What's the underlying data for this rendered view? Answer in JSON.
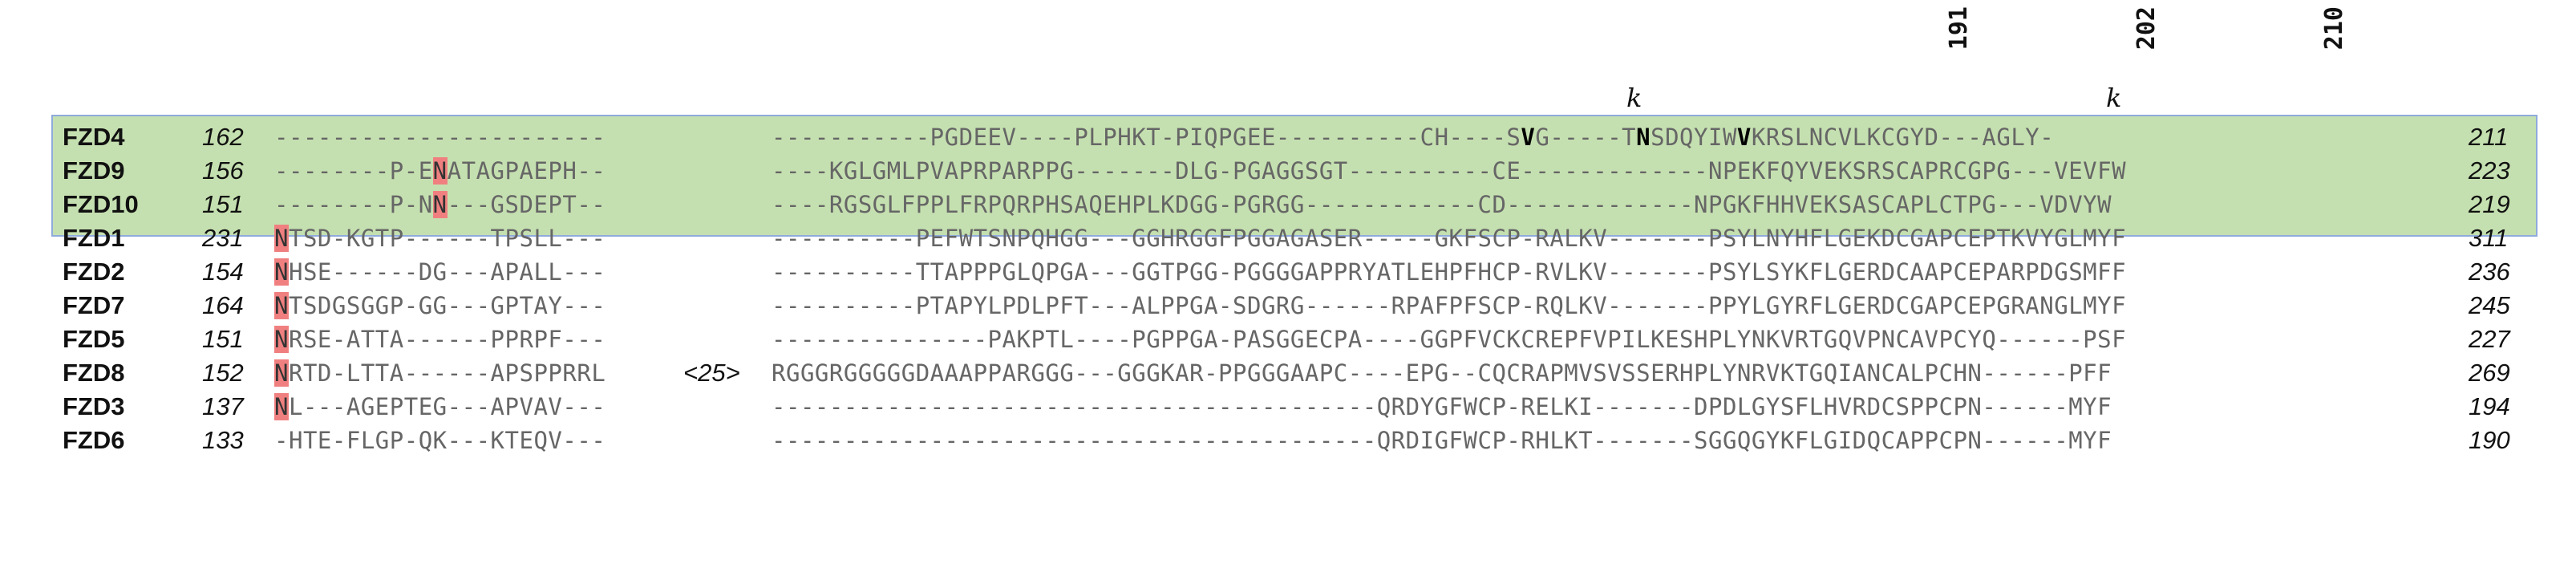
{
  "position_labels": [
    "191",
    "202",
    "210"
  ],
  "k_marks": [
    "k",
    "k"
  ],
  "highlight_colors": {
    "group_box": "#c5e0b0",
    "group_border": "#8faadc",
    "cysteine": "#ffff00",
    "asn_glyco": "#f08080"
  },
  "rows": [
    {
      "name": "FZD4",
      "start": "162",
      "end": "211",
      "insert": "",
      "seg1": "-----------------------",
      "seg2": "-----------PGDEEV----PLPHKT-PIQPGEE----------CH----SVG-----TNSDQYIWVKRSLNCVLKCGYD---AGLY-"
    },
    {
      "name": "FZD9",
      "start": "156",
      "end": "223",
      "insert": "",
      "seg1": "--------P-ENATAGPAEPH--",
      "seg2": "----KGLGMLPVAPRPARPPG-------DLG-PGAGGSGT----------CE-------------NPEKFQYVEKSRSCAPRCGPG---VEVFW"
    },
    {
      "name": "FZD10",
      "start": "151",
      "end": "219",
      "insert": "",
      "seg1": "--------P-NN---GSDEPT--",
      "seg2": "----RGSGLFPPLFRPQRPHSAQEHPLKDGG-PGRGG------------CD-------------NPGKFHHVEKSASCAPLCTPG---VDVYW"
    },
    {
      "name": "FZD1",
      "start": "231",
      "end": "311",
      "insert": "",
      "seg1": "NTSD-KGTP------TPSLL---",
      "seg2": "----------PEFWTSNPQHGG---GGHRGGFPGGAGASER-----GKFSCP-RALKV-------PSYLNYHFLGEKDCGAPCEPTKVYGLMYF"
    },
    {
      "name": "FZD2",
      "start": "154",
      "end": "236",
      "insert": "",
      "seg1": "NHSE------DG---APALL---",
      "seg2": "----------TTAPPPGLQPGA---GGTPGG-PGGGGAPPRYATLEHPFHCP-RVLKV-------PSYLSYKFLGERDCAAPCEPARPDGSMFF"
    },
    {
      "name": "FZD7",
      "start": "164",
      "end": "245",
      "insert": "",
      "seg1": "NTSDGSGGP-GG---GPTAY---",
      "seg2": "----------PTAPYLPDLPFT---ALPPGA-SDGRG------RPAFPFSCP-RQLKV-------PPYLGYRFLGERDCGAPCEPGRANGLMYF"
    },
    {
      "name": "FZD5",
      "start": "151",
      "end": "227",
      "insert": "",
      "seg1": "NRSE-ATTA------PPRPF---",
      "seg2": "---------------PAKPTL----PGPPGA-PASGGECPA----GGPFVCKCREPFVPILKESHPLYNKVRTGQVPNCAVPCYQ------PSF"
    },
    {
      "name": "FZD8",
      "start": "152",
      "end": "269",
      "insert": "<25>",
      "seg1": "NRTD-LTTA------APSPPRRL",
      "seg2": "RGGGRGGGGGDAAAPPARGGG---GGGKAR-PPGGGAAPC----EPG--CQCRAPMVSVSSERHPLYNRVKTGQIANCALPCHN------PFF"
    },
    {
      "name": "FZD3",
      "start": "137",
      "end": "194",
      "insert": "",
      "seg1": "NL---AGEPTEG---APVAV---",
      "seg2": "------------------------------------------QRDYGFWCP-RELKI-------DPDLGYSFLHVRDCSPPCPN------MYF"
    },
    {
      "name": "FZD6",
      "start": "133",
      "end": "190",
      "insert": "",
      "seg1": "-HTE-FLGP-QK---KTEQV---",
      "seg2": "------------------------------------------QRDIGFWCP-RHLKT-------SGGQGYKFLGIDQCAPPCPN------MYF"
    }
  ]
}
